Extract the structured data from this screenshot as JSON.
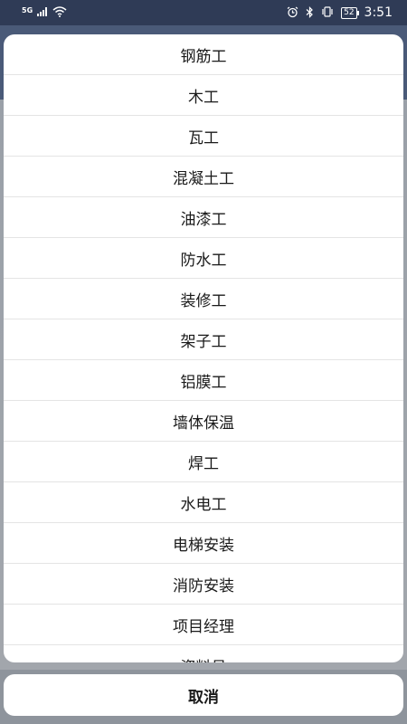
{
  "status_bar": {
    "network": "5G",
    "battery": "52",
    "time": "3:51",
    "icons": [
      "signal-icon",
      "wifi-icon",
      "alarm-icon",
      "bluetooth-icon",
      "vibrate-icon",
      "battery-icon"
    ]
  },
  "sheet": {
    "options": [
      "钢筋工",
      "木工",
      "瓦工",
      "混凝土工",
      "油漆工",
      "防水工",
      "装修工",
      "架子工",
      "铝膜工",
      "墙体保温",
      "焊工",
      "水电工",
      "电梯安装",
      "消防安装",
      "项目经理",
      "资料员"
    ],
    "cancel_label": "取消"
  }
}
